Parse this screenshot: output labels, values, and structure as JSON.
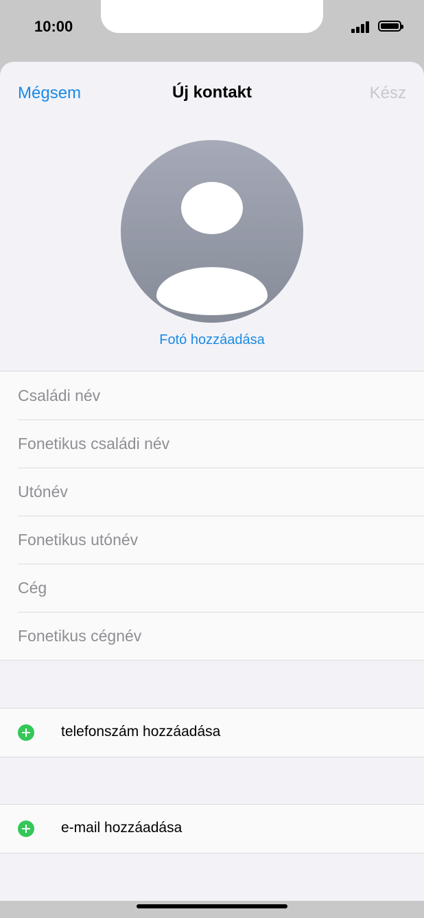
{
  "status_bar": {
    "time": "10:00"
  },
  "nav": {
    "cancel": "Mégsem",
    "title": "Új kontakt",
    "done": "Kész"
  },
  "photo": {
    "add_label": "Fotó hozzáadása"
  },
  "fields": [
    "Családi név",
    "Fonetikus családi név",
    "Utónév",
    "Fonetikus utónév",
    "Cég",
    "Fonetikus cégnév"
  ],
  "actions": {
    "add_phone": "telefonszám hozzáadása",
    "add_email": "e-mail hozzáadása"
  },
  "colors": {
    "accent": "#1a8ae5",
    "add_green": "#34c759",
    "placeholder": "#8e8e93",
    "disabled": "#c7c7cc"
  },
  "icons": [
    "signal-icon",
    "battery-icon",
    "avatar-icon",
    "plus-circle-icon"
  ]
}
